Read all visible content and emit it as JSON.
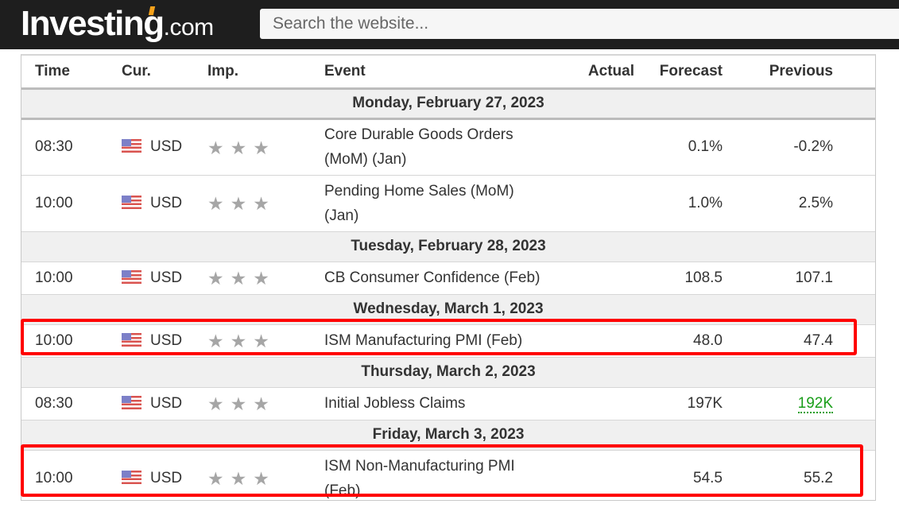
{
  "header": {
    "logo_main": "Investing",
    "logo_suffix": ".com",
    "search_placeholder": "Search the website..."
  },
  "table": {
    "columns": [
      "Time",
      "Cur.",
      "Imp.",
      "Event",
      "Actual",
      "Forecast",
      "Previous"
    ],
    "days": [
      {
        "date": "Monday, February 27, 2023",
        "events": [
          {
            "time": "08:30",
            "currency": "USD",
            "importance": 3,
            "event_line1": "Core Durable Goods Orders",
            "event_line2": "(MoM) (Jan)",
            "actual": "",
            "forecast": "0.1%",
            "previous": "-0.2%"
          },
          {
            "time": "10:00",
            "currency": "USD",
            "importance": 3,
            "event_line1": "Pending Home Sales (MoM)",
            "event_line2": "(Jan)",
            "actual": "",
            "forecast": "1.0%",
            "previous": "2.5%"
          }
        ]
      },
      {
        "date": "Tuesday, February 28, 2023",
        "events": [
          {
            "time": "10:00",
            "currency": "USD",
            "importance": 3,
            "event_line1": "CB Consumer Confidence (Feb)",
            "actual": "",
            "forecast": "108.5",
            "previous": "107.1"
          }
        ]
      },
      {
        "date": "Wednesday, March 1, 2023",
        "events": [
          {
            "time": "10:00",
            "currency": "USD",
            "importance": 3,
            "event_line1": "ISM Manufacturing PMI (Feb)",
            "actual": "",
            "forecast": "48.0",
            "previous": "47.4",
            "highlighted": true
          }
        ]
      },
      {
        "date": "Thursday, March 2, 2023",
        "events": [
          {
            "time": "08:30",
            "currency": "USD",
            "importance": 3,
            "event_line1": "Initial Jobless Claims",
            "actual": "",
            "forecast": "197K",
            "previous": "192K",
            "previous_color": "#1a9e1a"
          }
        ]
      },
      {
        "date": "Friday, March 3, 2023",
        "events": [
          {
            "time": "10:00",
            "currency": "USD",
            "importance": 3,
            "event_line1": "ISM Non-Manufacturing PMI",
            "event_line2": "(Feb)",
            "actual": "",
            "forecast": "54.5",
            "previous": "55.2",
            "highlighted": true
          }
        ]
      }
    ]
  },
  "icons": {
    "flag": "us-flag-icon",
    "star": "star-icon",
    "star_glyph": "★"
  },
  "colors": {
    "highlight": "#ff0000",
    "revised_previous": "#1a9e1a",
    "topbar": "#1e1e1e",
    "logo_accent": "#f7a21b"
  }
}
